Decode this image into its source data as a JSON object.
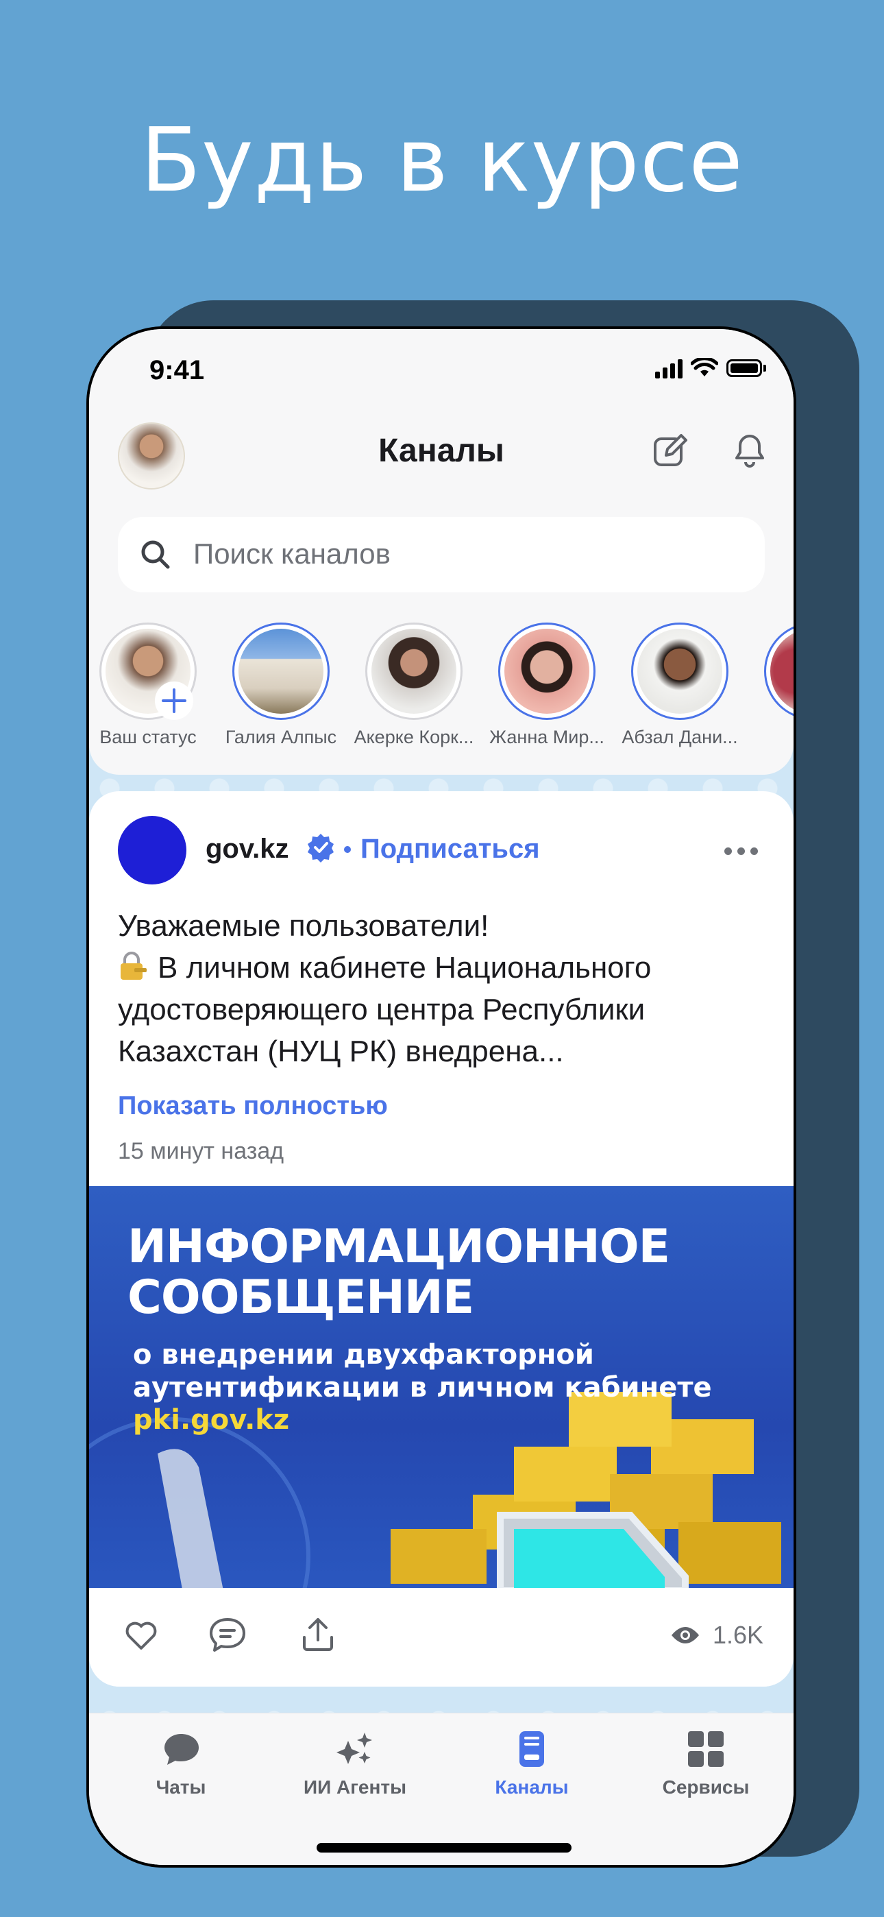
{
  "headline": "Будь в курсе",
  "status_bar": {
    "time": "9:41"
  },
  "header": {
    "title": "Каналы"
  },
  "search": {
    "placeholder": "Поиск каналов"
  },
  "stories": [
    {
      "name": "Ваш статус"
    },
    {
      "name": "Галия Алпыс"
    },
    {
      "name": "Акерке Корк..."
    },
    {
      "name": "Жанна Мир..."
    },
    {
      "name": "Абзал Дани..."
    }
  ],
  "post": {
    "channel": "gov.kz",
    "subscribe": "Подписаться",
    "text_lines": [
      "Уважаемые пользователи!",
      "В личном кабинете Национального",
      "удостоверяющего центра Республики",
      "Казахстан (НУЦ РК) внедрена..."
    ],
    "show_more": "Показать полностью",
    "time_ago": "15 минут назад",
    "banner": {
      "title_line1": "ИНФОРМАЦИОННОЕ",
      "title_line2": "СООБЩЕНИЕ",
      "sub_line1": "о внедрении двухфакторной",
      "sub_line2": "аутентификации в личном кабинете",
      "link": "pki.gov.kz"
    },
    "views": "1.6K"
  },
  "tabs": [
    {
      "label": "Чаты",
      "icon": "chat-bubble-icon",
      "active": false
    },
    {
      "label": "ИИ Агенты",
      "icon": "sparkles-icon",
      "active": false
    },
    {
      "label": "Каналы",
      "icon": "channels-icon",
      "active": true
    },
    {
      "label": "Сервисы",
      "icon": "grid-icon",
      "active": false
    }
  ],
  "colors": {
    "accent": "#4a73e8",
    "background": "#62a3d2",
    "banner": "#2a50b8",
    "gold": "#f6d838"
  }
}
